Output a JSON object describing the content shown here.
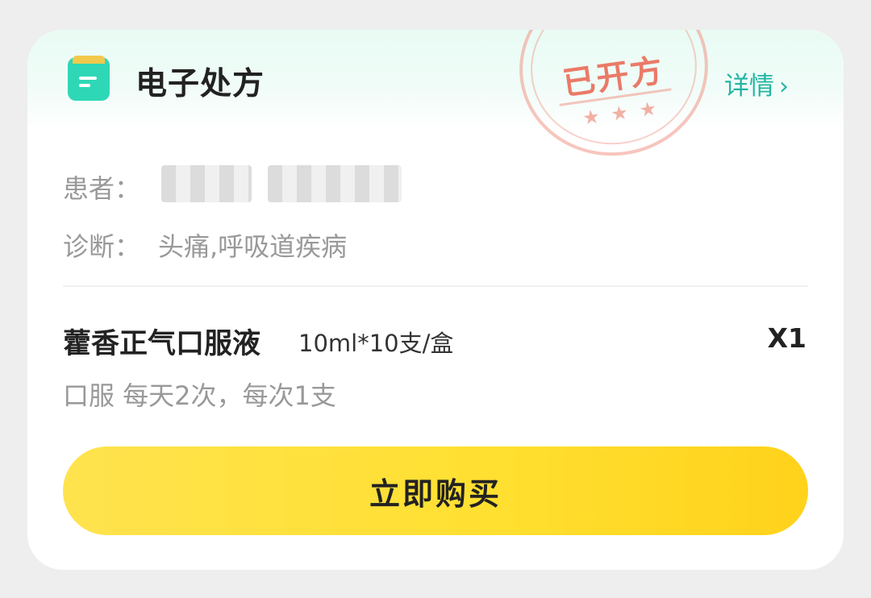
{
  "card": {
    "title": "电子处方",
    "detail_label": "详情",
    "detail_chevron": "›",
    "stamp": {
      "text": "已开方",
      "stars": "★★★"
    }
  },
  "patient": {
    "label": "患者："
  },
  "diagnosis": {
    "label": "诊断：",
    "value": "头痛,呼吸道疾病"
  },
  "drug": {
    "name": "藿香正气口服液",
    "spec": "10ml*10支/盒",
    "quantity": "X1",
    "usage": "口服 每天2次，每次1支"
  },
  "buy_button": {
    "label": "立即购买"
  },
  "colors": {
    "accent": "#22b5a3",
    "icon": "#2ed8b6",
    "button": "#ffdf2f",
    "stamp": "#e96c58"
  }
}
